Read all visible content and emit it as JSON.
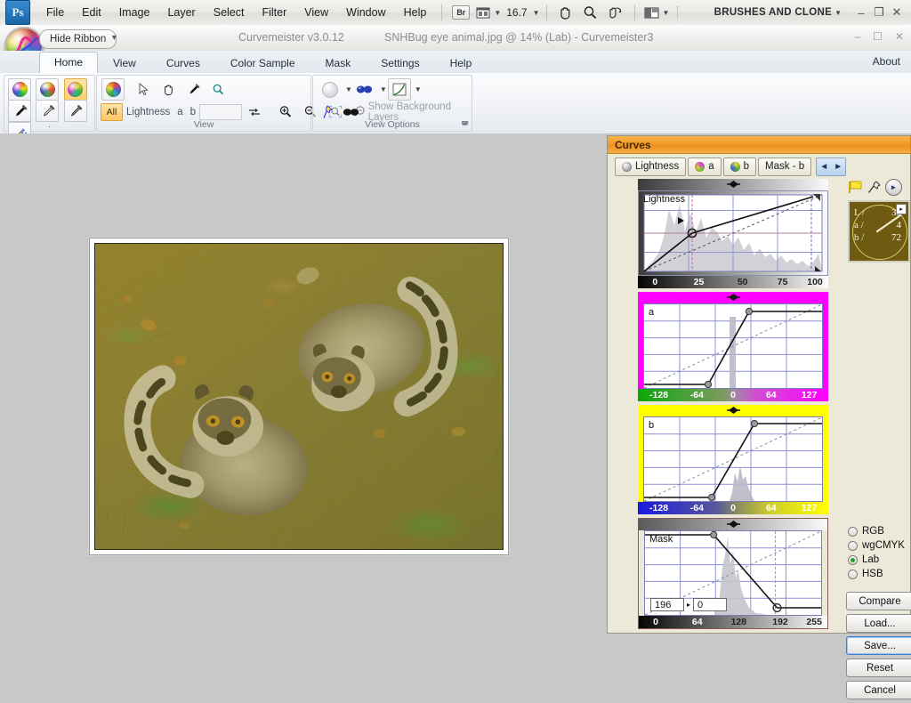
{
  "photoshop": {
    "logo": "Ps",
    "menus": [
      "File",
      "Edit",
      "Image",
      "Layer",
      "Select",
      "Filter",
      "View",
      "Window",
      "Help"
    ],
    "bridge_button": "Br",
    "zoom_value": "16.7",
    "workspace": "BRUSHES AND CLONE",
    "tool_icons": [
      "bridge-icon",
      "screen-mode-icon",
      "hand-icon",
      "zoom-icon",
      "rotate-view-icon",
      "arrange-documents-icon"
    ],
    "window_buttons": [
      "minimize",
      "restore",
      "close"
    ]
  },
  "curvemeister": {
    "hide_ribbon": "Hide Ribbon",
    "app_title": "Curvemeister v3.0.12",
    "document_title": "SNHBug eye animal.jpg @ 14% (Lab) - Curvemeister3",
    "window_buttons": [
      "minimize",
      "maximize",
      "close"
    ],
    "about": "About",
    "tabs": [
      {
        "label": "Home",
        "active": true
      },
      {
        "label": "View",
        "active": false
      },
      {
        "label": "Curves",
        "active": false
      },
      {
        "label": "Color Sample",
        "active": false
      },
      {
        "label": "Mask",
        "active": false
      },
      {
        "label": "Settings",
        "active": false
      },
      {
        "label": "Help",
        "active": false
      }
    ],
    "ribbon_groups": [
      {
        "label": ".",
        "row1": [
          "color-ball-1-icon",
          "color-ball-2-icon",
          "color-ball-3-icon",
          "color-ball-4-icon"
        ],
        "row2": [
          "eyedropper-black-icon",
          "eyedropper-white-icon",
          "eyedropper-gray-icon",
          "magic-wand-icon"
        ]
      },
      {
        "label": "View",
        "row1": [
          "curvemeister-orb-icon",
          "arrow-select-icon",
          "hand-icon",
          "eyedropper-icon",
          "magnifier-icon"
        ],
        "channel_all": "All",
        "channels": [
          "Lightness",
          "a",
          "b"
        ],
        "row2_icons": [
          "swap-icon",
          "zoom-in-icon",
          "zoom-out-icon",
          "zoom-fit-icon",
          "zoom-actual-icon"
        ]
      },
      {
        "label": "View Options",
        "row1": [
          "sphere-preview-icon",
          "glasses-icon",
          "curve-preview-icon"
        ],
        "pin_icon": "pushpin-icon",
        "mask_icon": "glasses-mask-icon",
        "show_background": "Show Background Layers",
        "dialog_launcher": "dialog-launcher-icon"
      }
    ]
  },
  "curves_panel": {
    "title": "Curves",
    "channel_tabs": [
      {
        "label": "Lightness",
        "icon": "channel-lightness-icon"
      },
      {
        "label": "a",
        "icon": "channel-a-icon"
      },
      {
        "label": "b",
        "icon": "channel-b-icon"
      },
      {
        "label": "Mask - b",
        "icon": "channel-mask-icon"
      }
    ],
    "nav_prev": "◄",
    "nav_next": "►",
    "header_icons": [
      "flag-icon",
      "pin-icon",
      "play-icon"
    ],
    "readout": {
      "labels": [
        "L /",
        "a /",
        "b /"
      ],
      "values": [
        "39",
        "4",
        "72"
      ],
      "expand_icon": "expand-readout-icon"
    },
    "color_space_options": [
      {
        "label": "RGB",
        "selected": false
      },
      {
        "label": "wgCMYK",
        "selected": false
      },
      {
        "label": "Lab",
        "selected": true
      },
      {
        "label": "HSB",
        "selected": false
      }
    ],
    "buttons": [
      {
        "label": "Compare",
        "focused": false
      },
      {
        "label": "Load...",
        "focused": false
      },
      {
        "label": "Save...",
        "focused": true
      },
      {
        "label": "Reset",
        "focused": false
      },
      {
        "label": "Cancel",
        "focused": false
      }
    ],
    "mask_inputs": {
      "from": "196",
      "arrow": "▸",
      "to": "0"
    }
  },
  "chart_data": [
    {
      "type": "line",
      "name": "lightness-curve",
      "title": "Lightness",
      "xlabel": "",
      "ylabel": "",
      "xlim": [
        0,
        100
      ],
      "ylim": [
        0,
        100
      ],
      "ticks": [
        "0",
        "25",
        "50",
        "75",
        "100"
      ],
      "tick_positions": [
        0,
        25,
        50,
        75,
        100
      ],
      "grid": true,
      "gradient": "black-to-white",
      "series": [
        {
          "name": "curve",
          "x": [
            0,
            27,
            100
          ],
          "y": [
            0,
            47,
            98
          ],
          "style": "solid"
        },
        {
          "name": "identity",
          "x": [
            0,
            100
          ],
          "y": [
            0,
            100
          ],
          "style": "dashed"
        }
      ],
      "control_points": [
        {
          "x": 27,
          "y": 47
        }
      ],
      "histogram": true,
      "marker_guides": {
        "x": 27,
        "y": 47
      }
    },
    {
      "type": "line",
      "name": "a-curve",
      "title": "a",
      "xlim": [
        -128,
        127
      ],
      "ylim": [
        -128,
        127
      ],
      "ticks": [
        "-128",
        "-64",
        "0",
        "64",
        "127"
      ],
      "tick_positions": [
        -128,
        -64,
        0,
        64,
        127
      ],
      "grid": true,
      "gradient": "green-to-magenta",
      "border_color": "#ff00ff",
      "series": [
        {
          "name": "curve",
          "x": [
            -128,
            -48,
            18,
            127
          ],
          "y": [
            -128,
            -128,
            110,
            110
          ],
          "style": "solid"
        },
        {
          "name": "identity",
          "x": [
            -128,
            127
          ],
          "y": [
            -128,
            127
          ],
          "style": "dashed"
        }
      ],
      "control_points": [
        {
          "x": -48,
          "y": -128
        },
        {
          "x": 18,
          "y": 110
        }
      ],
      "histogram": true
    },
    {
      "type": "line",
      "name": "b-curve",
      "title": "b",
      "xlim": [
        -128,
        127
      ],
      "ylim": [
        -128,
        127
      ],
      "ticks": [
        "-128",
        "-64",
        "0",
        "64",
        "127"
      ],
      "tick_positions": [
        -128,
        -64,
        0,
        64,
        127
      ],
      "grid": true,
      "gradient": "blue-to-yellow",
      "border_color": "#ffff00",
      "series": [
        {
          "name": "curve",
          "x": [
            -128,
            -40,
            22,
            127
          ],
          "y": [
            -128,
            -128,
            115,
            115
          ],
          "style": "solid"
        },
        {
          "name": "identity",
          "x": [
            -128,
            127
          ],
          "y": [
            -128,
            127
          ],
          "style": "dashed"
        }
      ],
      "control_points": [
        {
          "x": -40,
          "y": -128
        },
        {
          "x": 22,
          "y": 115
        }
      ],
      "histogram": true
    },
    {
      "type": "line",
      "name": "mask-curve",
      "title": "Mask",
      "xlim": [
        0,
        255
      ],
      "ylim": [
        0,
        255
      ],
      "ticks": [
        "0",
        "64",
        "128",
        "192",
        "255"
      ],
      "tick_positions": [
        0,
        64,
        128,
        192,
        255
      ],
      "grid": true,
      "gradient": "black-to-white",
      "series": [
        {
          "name": "curve",
          "x": [
            0,
            118,
            196,
            255
          ],
          "y": [
            255,
            255,
            8,
            8
          ],
          "style": "solid"
        },
        {
          "name": "identity",
          "x": [
            0,
            255
          ],
          "y": [
            0,
            255
          ],
          "style": "dashed"
        }
      ],
      "control_points": [
        {
          "x": 118,
          "y": 255
        },
        {
          "x": 196,
          "y": 8
        }
      ],
      "histogram": true
    }
  ]
}
